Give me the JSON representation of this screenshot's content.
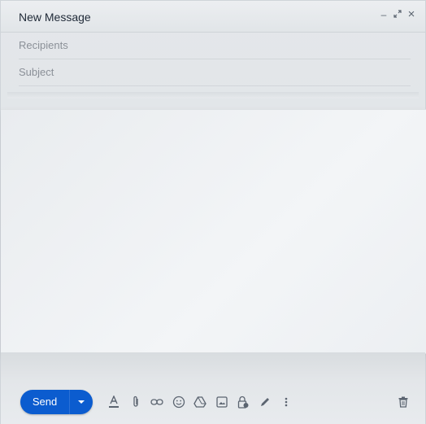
{
  "compose": {
    "title": "New Message",
    "recipients_placeholder": "Recipients",
    "subject_placeholder": "Subject",
    "body": ""
  },
  "window_controls": {
    "minimize": "–",
    "expand": "⤢",
    "close": "×"
  },
  "toolbar": {
    "send_label": "Send",
    "accent": "#0b5ccf",
    "tools": [
      "format-text-icon",
      "attach-icon",
      "link-icon",
      "emoji-icon",
      "drive-icon",
      "image-icon",
      "lock-clock-icon",
      "signature-pen-icon",
      "more-options-icon"
    ],
    "discard": "trash-icon"
  }
}
